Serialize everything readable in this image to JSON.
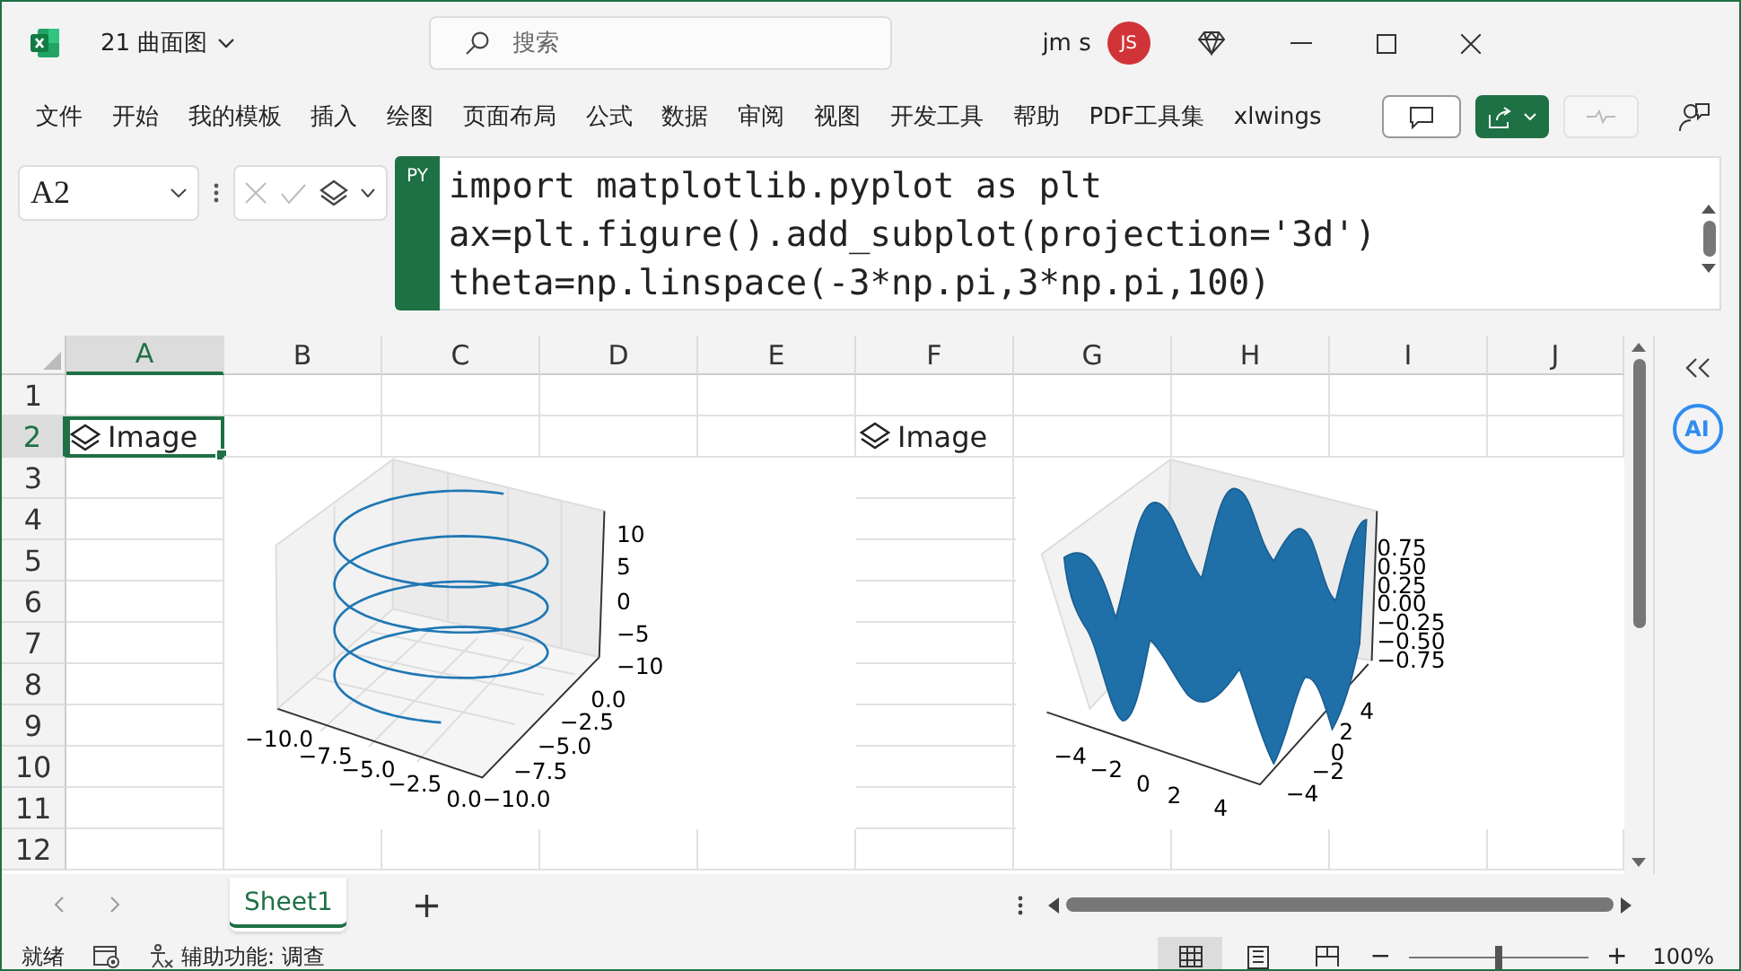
{
  "title_bar": {
    "file_name": "21 曲面图",
    "search_placeholder": "搜索",
    "user_name": "jm s",
    "avatar_initials": "JS"
  },
  "ribbon_tabs": [
    "文件",
    "开始",
    "我的模板",
    "插入",
    "绘图",
    "页面布局",
    "公式",
    "数据",
    "审阅",
    "视图",
    "开发工具",
    "帮助",
    "PDF工具集",
    "xlwings"
  ],
  "formula_bar": {
    "name_box": "A2",
    "python_badge": "PY",
    "lines": [
      "import matplotlib.pyplot as plt",
      "ax=plt.figure().add_subplot(projection='3d')",
      "theta=np.linspace(-3*np.pi,3*np.pi,100)"
    ]
  },
  "columns": [
    {
      "label": "A",
      "selected": true
    },
    {
      "label": "B",
      "selected": false
    },
    {
      "label": "C",
      "selected": false
    },
    {
      "label": "D",
      "selected": false
    },
    {
      "label": "E",
      "selected": false
    },
    {
      "label": "F",
      "selected": false
    },
    {
      "label": "G",
      "selected": false
    },
    {
      "label": "H",
      "selected": false
    },
    {
      "label": "I",
      "selected": false
    },
    {
      "label": "J",
      "selected": false
    }
  ],
  "rows": [
    {
      "label": "1",
      "selected": false
    },
    {
      "label": "2",
      "selected": true
    },
    {
      "label": "3",
      "selected": false
    },
    {
      "label": "4",
      "selected": false
    },
    {
      "label": "5",
      "selected": false
    },
    {
      "label": "6",
      "selected": false
    },
    {
      "label": "7",
      "selected": false
    },
    {
      "label": "8",
      "selected": false
    },
    {
      "label": "9",
      "selected": false
    },
    {
      "label": "10",
      "selected": false
    },
    {
      "label": "11",
      "selected": false
    },
    {
      "label": "12",
      "selected": false
    }
  ],
  "image_cells": [
    {
      "text": "Image",
      "selected": true
    },
    {
      "text": "Image",
      "selected": false
    }
  ],
  "side_panel": {
    "ai_button": "AI"
  },
  "plots": [
    {
      "kind": "helix",
      "z_ticks": [
        "10",
        "5",
        "0",
        "−5",
        "−10"
      ],
      "y_ticks": [
        "0.0",
        "−2.5",
        "−5.0",
        "−7.5",
        "−10.0"
      ],
      "x_ticks": [
        "−10.0",
        "−7.5",
        "−5.0",
        "−2.5",
        "0.0"
      ]
    },
    {
      "kind": "surface",
      "z_ticks": [
        "0.75",
        "0.50",
        "0.25",
        "0.00",
        "−0.25",
        "−0.50",
        "−0.75"
      ],
      "y_ticks": [
        "4",
        "2",
        "0",
        "−2",
        "−4"
      ],
      "x_ticks": [
        "−4",
        "−2",
        "0",
        "2",
        "4"
      ]
    }
  ],
  "sheet_tabs": [
    {
      "label": "Sheet1",
      "selected": true
    }
  ],
  "new_sheet": "+",
  "status_bar": {
    "ready": "就绪",
    "accessibility": "辅助功能: 调查",
    "zoom_out": "−",
    "zoom_in": "+",
    "zoom_slider": {
      "level": 0.5
    },
    "zoom": "100%"
  }
}
